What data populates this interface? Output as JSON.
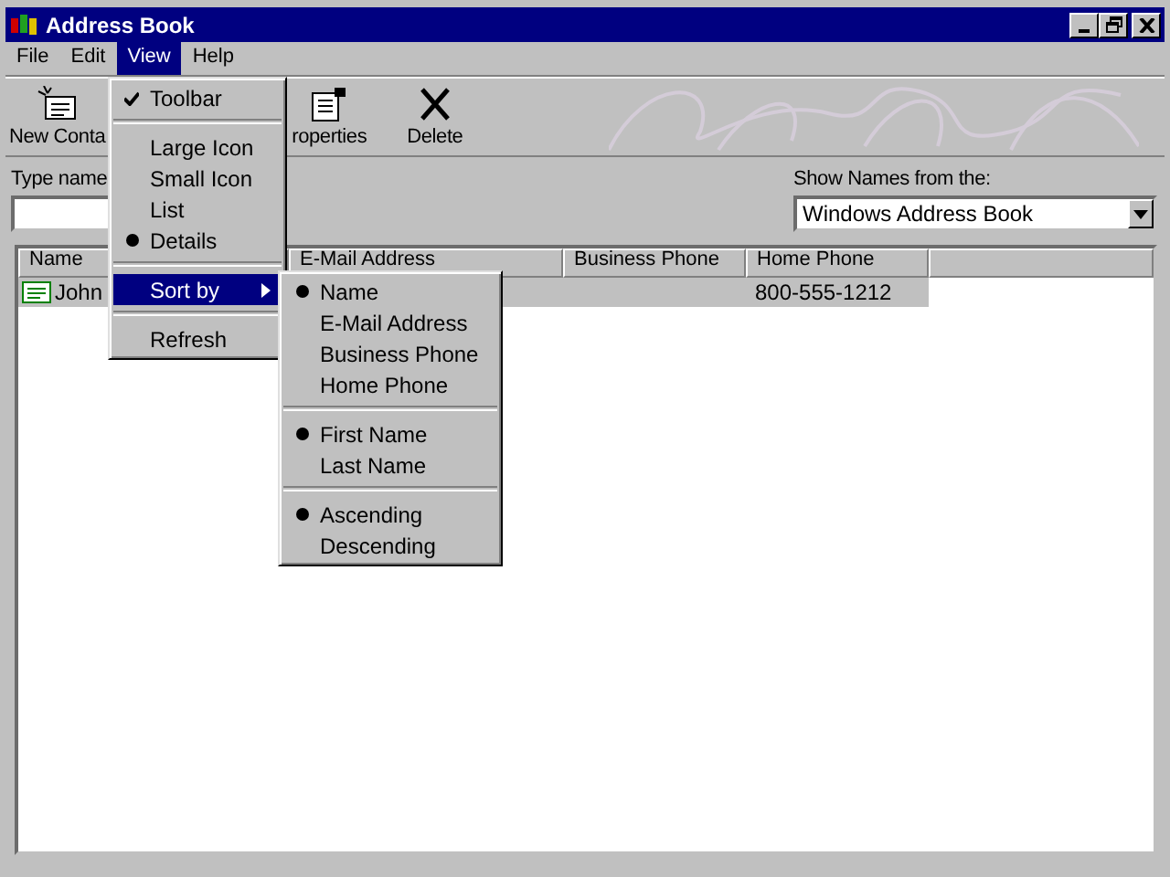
{
  "window": {
    "title": "Address Book"
  },
  "menu_bar": [
    {
      "label": "File",
      "selected": false
    },
    {
      "label": "Edit",
      "selected": false
    },
    {
      "label": "View",
      "selected": true
    },
    {
      "label": "Help",
      "selected": false
    }
  ],
  "toolbar": [
    {
      "kind": "new-contact",
      "label": "New Conta"
    },
    {
      "kind": "properties",
      "label": "roperties"
    },
    {
      "kind": "delete",
      "label": "Delete"
    }
  ],
  "search": {
    "label": "Type name"
  },
  "source": {
    "label": "Show Names from the:",
    "value": "Windows Address Book"
  },
  "table": {
    "columns": [
      "Name",
      "E-Mail Address",
      "Business Phone",
      "Home Phone"
    ],
    "rows": [
      {
        "name": "John",
        "email": "",
        "business_phone": "",
        "home_phone": "800-555-1212",
        "selected": true
      }
    ]
  },
  "view_menu": [
    {
      "kind": "check",
      "label": "Toolbar",
      "checked": true
    },
    {
      "kind": "separator"
    },
    {
      "kind": "radio",
      "label": "Large Icon",
      "checked": false
    },
    {
      "kind": "radio",
      "label": "Small Icon",
      "checked": false
    },
    {
      "kind": "radio",
      "label": "List",
      "checked": false
    },
    {
      "kind": "radio",
      "label": "Details",
      "checked": true
    },
    {
      "kind": "separator"
    },
    {
      "kind": "submenu",
      "label": "Sort by",
      "selected": true
    },
    {
      "kind": "separator"
    },
    {
      "kind": "command",
      "label": "Refresh"
    }
  ],
  "sort_menu": [
    {
      "kind": "radio",
      "label": "Name",
      "checked": true
    },
    {
      "kind": "radio",
      "label": "E-Mail Address",
      "checked": false
    },
    {
      "kind": "radio",
      "label": "Business Phone",
      "checked": false
    },
    {
      "kind": "radio",
      "label": "Home Phone",
      "checked": false
    },
    {
      "kind": "separator"
    },
    {
      "kind": "radio",
      "label": "First Name",
      "checked": true
    },
    {
      "kind": "radio",
      "label": "Last Name",
      "checked": false
    },
    {
      "kind": "separator"
    },
    {
      "kind": "radio",
      "label": "Ascending",
      "checked": true
    },
    {
      "kind": "radio",
      "label": "Descending",
      "checked": false
    }
  ]
}
